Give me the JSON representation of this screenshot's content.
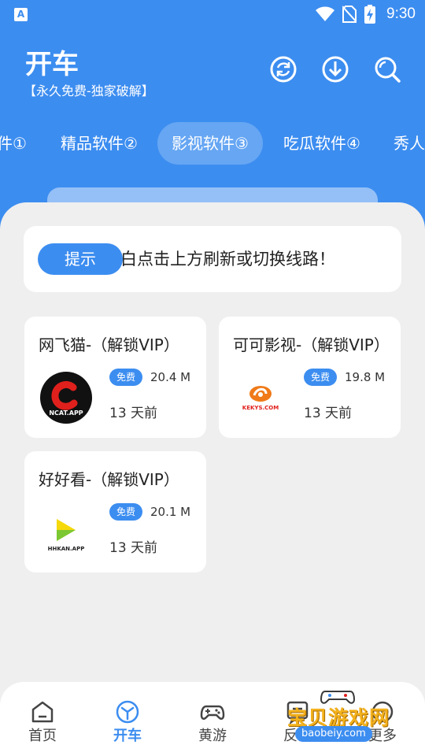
{
  "status_bar": {
    "time": "9:30",
    "app_icon_letter": "A",
    "icons": [
      "notification-app-icon",
      "wifi-icon",
      "no-sim-icon",
      "battery-charging-icon"
    ]
  },
  "header": {
    "title": "开车",
    "subtitle": "【永久免费-独家破解】",
    "actions": [
      "refresh-icon",
      "download-icon",
      "search-icon"
    ]
  },
  "tabs": [
    {
      "label": "件①",
      "active": false
    },
    {
      "label": "精品软件②",
      "active": false
    },
    {
      "label": "影视软件③",
      "active": true
    },
    {
      "label": "吃瓜软件④",
      "active": false
    },
    {
      "label": "秀人",
      "active": false
    }
  ],
  "notice": {
    "badge": "提示",
    "text": "提示空白点击上方刷新或切换线路！"
  },
  "apps": [
    {
      "title": "网飞猫-（解锁VIP）",
      "badge": "免费",
      "size": "20.4 M",
      "time": "13 天前",
      "logo_text": "NCAT.APP"
    },
    {
      "title": "可可影视-（解锁VIP）",
      "badge": "免费",
      "size": "19.8 M",
      "time": "13 天前",
      "logo_text": "KEKYS.COM"
    },
    {
      "title": "好好看-（解锁VIP）",
      "badge": "免费",
      "size": "20.1 M",
      "time": "13 天前",
      "logo_text": "HHKAN.APP"
    }
  ],
  "bottom_nav": [
    {
      "label": "首页",
      "icon": "home-icon",
      "active": false
    },
    {
      "label": "开车",
      "icon": "cube-icon",
      "active": true
    },
    {
      "label": "黄游",
      "icon": "gamepad-icon",
      "active": false
    },
    {
      "label": "反馈",
      "icon": "feedback-icon",
      "active": false
    },
    {
      "label": "更多",
      "icon": "more-icon",
      "active": false
    }
  ],
  "watermark": {
    "text": "宝贝游戏网",
    "url": "baobeiy.com"
  },
  "colors": {
    "primary": "#3c8df0",
    "background": "#efefef",
    "card": "#ffffff"
  }
}
